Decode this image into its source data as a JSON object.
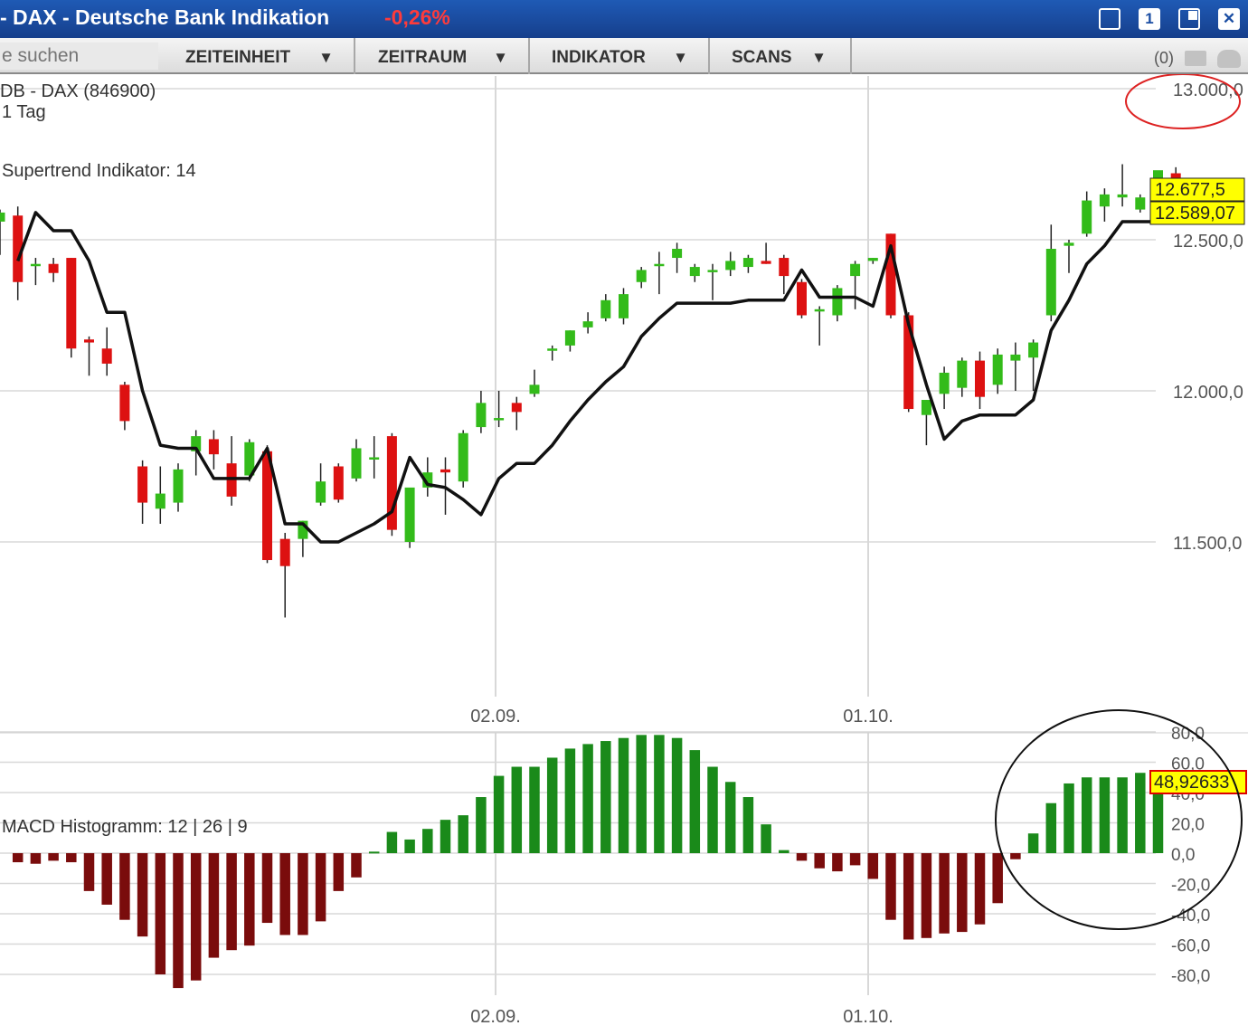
{
  "window": {
    "title": "- DAX - Deutsche Bank Indikation",
    "change": "-0,26%",
    "buttons": [
      "",
      "1",
      "",
      "✕"
    ]
  },
  "toolbar": {
    "search_placeholder": "e suchen",
    "zeiteinheit": "ZEITEINHEIT",
    "zeitraum": "ZEITRAUM",
    "indikator": "INDIKATOR",
    "scans": "SCANS",
    "arrow": "▼",
    "count": "(0)",
    "folder_icon": "folder-icon",
    "cloud_icon": "cloud-icon"
  },
  "chart_data": [
    {
      "type": "candlestick",
      "title": "DB - DAX (846900)",
      "subtitle": "1 Tag",
      "indicator": "Supertrend Indikator: 14",
      "y_ticks": [
        "13.000,0",
        "12.500,0",
        "12.000,0",
        "11.500,0"
      ],
      "y_tick_values": [
        13000,
        12500,
        12000,
        11500
      ],
      "x_ticks": [
        "02.09.",
        "01.10."
      ],
      "x_tick_index": [
        27,
        48
      ],
      "last_price_label": "12.677,5",
      "supertrend_label": "12.589,07",
      "last_price": 12677.5,
      "supertrend_last": 12589.07,
      "colors": {
        "up": "#33bb1a",
        "down": "#dd1111",
        "supertrend": "#111111",
        "label_bg": "#ffff00"
      },
      "candles": [
        {
          "o": 12560,
          "h": 12600,
          "l": 12450,
          "c": 12590
        },
        {
          "o": 12580,
          "h": 12610,
          "l": 12300,
          "c": 12360
        },
        {
          "o": 12420,
          "h": 12440,
          "l": 12350,
          "c": 12420
        },
        {
          "o": 12420,
          "h": 12440,
          "l": 12360,
          "c": 12390
        },
        {
          "o": 12440,
          "h": 12440,
          "l": 12110,
          "c": 12140
        },
        {
          "o": 12170,
          "h": 12180,
          "l": 12050,
          "c": 12160
        },
        {
          "o": 12140,
          "h": 12210,
          "l": 12050,
          "c": 12090
        },
        {
          "o": 12020,
          "h": 12030,
          "l": 11870,
          "c": 11900
        },
        {
          "o": 11750,
          "h": 11770,
          "l": 11560,
          "c": 11630
        },
        {
          "o": 11610,
          "h": 11750,
          "l": 11560,
          "c": 11660
        },
        {
          "o": 11630,
          "h": 11760,
          "l": 11600,
          "c": 11740
        },
        {
          "o": 11800,
          "h": 11870,
          "l": 11720,
          "c": 11850
        },
        {
          "o": 11840,
          "h": 11870,
          "l": 11740,
          "c": 11790
        },
        {
          "o": 11760,
          "h": 11850,
          "l": 11620,
          "c": 11650
        },
        {
          "o": 11720,
          "h": 11840,
          "l": 11700,
          "c": 11830
        },
        {
          "o": 11800,
          "h": 11820,
          "l": 11430,
          "c": 11440
        },
        {
          "o": 11510,
          "h": 11530,
          "l": 11250,
          "c": 11420
        },
        {
          "o": 11510,
          "h": 11570,
          "l": 11450,
          "c": 11570
        },
        {
          "o": 11630,
          "h": 11760,
          "l": 11620,
          "c": 11700
        },
        {
          "o": 11750,
          "h": 11760,
          "l": 11630,
          "c": 11640
        },
        {
          "o": 11710,
          "h": 11840,
          "l": 11700,
          "c": 11810
        },
        {
          "o": 11780,
          "h": 11850,
          "l": 11710,
          "c": 11780
        },
        {
          "o": 11850,
          "h": 11860,
          "l": 11520,
          "c": 11540
        },
        {
          "o": 11500,
          "h": 11660,
          "l": 11480,
          "c": 11680
        },
        {
          "o": 11680,
          "h": 11780,
          "l": 11650,
          "c": 11730
        },
        {
          "o": 11740,
          "h": 11780,
          "l": 11590,
          "c": 11730
        },
        {
          "o": 11700,
          "h": 11870,
          "l": 11680,
          "c": 11860
        },
        {
          "o": 11880,
          "h": 12000,
          "l": 11860,
          "c": 11960
        },
        {
          "o": 11910,
          "h": 12000,
          "l": 11880,
          "c": 11910
        },
        {
          "o": 11960,
          "h": 11980,
          "l": 11870,
          "c": 11930
        },
        {
          "o": 11990,
          "h": 12070,
          "l": 11980,
          "c": 12020
        },
        {
          "o": 12140,
          "h": 12150,
          "l": 12100,
          "c": 12140
        },
        {
          "o": 12150,
          "h": 12200,
          "l": 12130,
          "c": 12200
        },
        {
          "o": 12210,
          "h": 12260,
          "l": 12190,
          "c": 12230
        },
        {
          "o": 12240,
          "h": 12320,
          "l": 12230,
          "c": 12300
        },
        {
          "o": 12240,
          "h": 12340,
          "l": 12220,
          "c": 12320
        },
        {
          "o": 12360,
          "h": 12410,
          "l": 12340,
          "c": 12400
        },
        {
          "o": 12420,
          "h": 12460,
          "l": 12320,
          "c": 12420
        },
        {
          "o": 12440,
          "h": 12490,
          "l": 12390,
          "c": 12470
        },
        {
          "o": 12380,
          "h": 12420,
          "l": 12360,
          "c": 12410
        },
        {
          "o": 12400,
          "h": 12420,
          "l": 12300,
          "c": 12400
        },
        {
          "o": 12400,
          "h": 12460,
          "l": 12380,
          "c": 12430
        },
        {
          "o": 12410,
          "h": 12450,
          "l": 12390,
          "c": 12440
        },
        {
          "o": 12430,
          "h": 12490,
          "l": 12420,
          "c": 12420
        },
        {
          "o": 12440,
          "h": 12450,
          "l": 12320,
          "c": 12380
        },
        {
          "o": 12360,
          "h": 12370,
          "l": 12240,
          "c": 12250
        },
        {
          "o": 12270,
          "h": 12280,
          "l": 12150,
          "c": 12270
        },
        {
          "o": 12250,
          "h": 12350,
          "l": 12230,
          "c": 12340
        },
        {
          "o": 12380,
          "h": 12430,
          "l": 12270,
          "c": 12420
        },
        {
          "o": 12430,
          "h": 12440,
          "l": 12420,
          "c": 12440
        },
        {
          "o": 12520,
          "h": 12520,
          "l": 12240,
          "c": 12250
        },
        {
          "o": 12250,
          "h": 12260,
          "l": 11930,
          "c": 11940
        },
        {
          "o": 11920,
          "h": 11970,
          "l": 11820,
          "c": 11970
        },
        {
          "o": 11990,
          "h": 12080,
          "l": 11940,
          "c": 12060
        },
        {
          "o": 12010,
          "h": 12110,
          "l": 11980,
          "c": 12100
        },
        {
          "o": 12100,
          "h": 12130,
          "l": 11940,
          "c": 11980
        },
        {
          "o": 12020,
          "h": 12140,
          "l": 11990,
          "c": 12120
        },
        {
          "o": 12100,
          "h": 12160,
          "l": 12000,
          "c": 12120
        },
        {
          "o": 12110,
          "h": 12170,
          "l": 12000,
          "c": 12160
        },
        {
          "o": 12250,
          "h": 12550,
          "l": 12230,
          "c": 12470
        },
        {
          "o": 12480,
          "h": 12500,
          "l": 12390,
          "c": 12490
        },
        {
          "o": 12520,
          "h": 12660,
          "l": 12510,
          "c": 12630
        },
        {
          "o": 12610,
          "h": 12670,
          "l": 12560,
          "c": 12650
        },
        {
          "o": 12640,
          "h": 12750,
          "l": 12610,
          "c": 12650
        },
        {
          "o": 12600,
          "h": 12650,
          "l": 12590,
          "c": 12640
        },
        {
          "o": 12650,
          "h": 12720,
          "l": 12640,
          "c": 12730
        },
        {
          "o": 12720,
          "h": 12740,
          "l": 12660,
          "c": 12670
        }
      ],
      "supertrend": [
        12430,
        12590,
        12530,
        12530,
        12430,
        12260,
        12260,
        12000,
        11820,
        11810,
        11810,
        11710,
        11710,
        11710,
        11810,
        11560,
        11560,
        11500,
        11500,
        11530,
        11560,
        11600,
        11780,
        11690,
        11680,
        11640,
        11590,
        11710,
        11760,
        11760,
        11820,
        11900,
        11970,
        12030,
        12080,
        12180,
        12240,
        12290,
        12290,
        12290,
        12290,
        12300,
        12300,
        12300,
        12400,
        12310,
        12310,
        12310,
        12280,
        12480,
        12220,
        12020,
        11840,
        11900,
        11920,
        11920,
        11920,
        11970,
        12200,
        12300,
        12420,
        12480,
        12560,
        12560,
        12560,
        12580
      ]
    },
    {
      "type": "bar",
      "title": "MACD Histogramm: 12 | 26 | 9",
      "y_ticks": [
        "80,0",
        "60,0",
        "40,0",
        "20,0",
        "0,0",
        "-20,0",
        "-40,0",
        "-60,0",
        "-80,0"
      ],
      "y_tick_values": [
        80,
        60,
        40,
        20,
        0,
        -20,
        -40,
        -60,
        -80
      ],
      "x_ticks": [
        "02.09.",
        "01.10."
      ],
      "last_value_label": "48,92633",
      "last_value": 48.92633,
      "colors": {
        "positive": "#1a8a1a",
        "negative": "#7a0c0c"
      },
      "values": [
        -6,
        -7,
        -5,
        -6,
        -25,
        -34,
        -44,
        -55,
        -80,
        -89,
        -84,
        -69,
        -64,
        -61,
        -46,
        -54,
        -54,
        -45,
        -25,
        -16,
        1,
        14,
        9,
        16,
        22,
        25,
        37,
        51,
        57,
        57,
        63,
        69,
        72,
        74,
        76,
        78,
        78,
        76,
        68,
        57,
        47,
        37,
        19,
        2,
        -5,
        -10,
        -12,
        -8,
        -17,
        -44,
        -57,
        -56,
        -53,
        -52,
        -47,
        -33,
        -4,
        13,
        33,
        46,
        50,
        50,
        50,
        53,
        48
      ]
    }
  ]
}
